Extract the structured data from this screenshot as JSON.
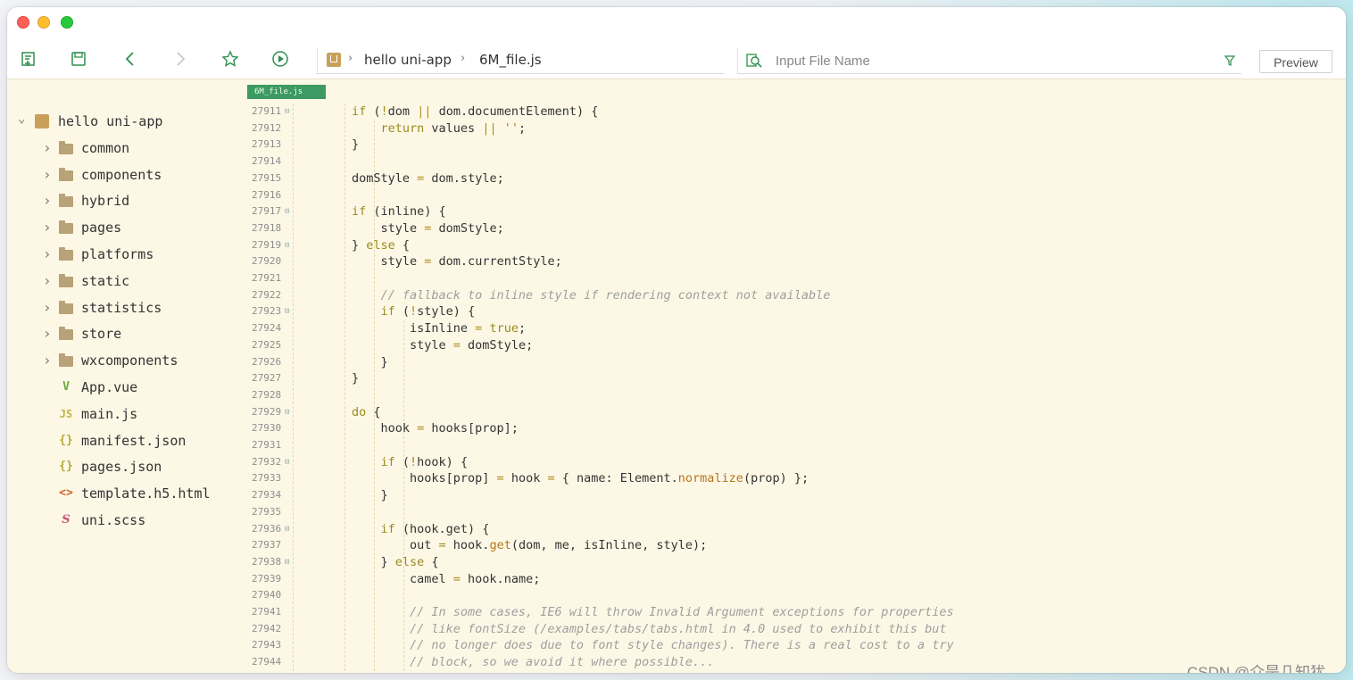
{
  "toolbar": {
    "breadcrumb": {
      "project": "hello uni-app",
      "file": "6M_file.js"
    },
    "search": {
      "placeholder": "Input File Name"
    },
    "preview_label": "Preview"
  },
  "sidebar": {
    "root": "hello uni-app",
    "folders": [
      "common",
      "components",
      "hybrid",
      "pages",
      "platforms",
      "static",
      "statistics",
      "store",
      "wxcomponents"
    ],
    "files": [
      {
        "name": "App.vue",
        "icon": "vue-icon",
        "color": "#6aa840"
      },
      {
        "name": "main.js",
        "icon": "js-icon",
        "color": "#c3b347"
      },
      {
        "name": "manifest.json",
        "icon": "json-icon",
        "color": "#b8a83a"
      },
      {
        "name": "pages.json",
        "icon": "json-icon",
        "color": "#b8a83a"
      },
      {
        "name": "template.h5.html",
        "icon": "html-icon",
        "color": "#d0622e"
      },
      {
        "name": "uni.scss",
        "icon": "scss-icon",
        "color": "#c9547a"
      }
    ]
  },
  "editor": {
    "tab_label": "6M_file.js",
    "lines": [
      {
        "n": "27911",
        "fold": true,
        "indent": 1,
        "text": "if (!dom || dom.documentElement) {"
      },
      {
        "n": "27912",
        "fold": false,
        "indent": 2,
        "text": "return values || '';"
      },
      {
        "n": "27913",
        "fold": false,
        "indent": 1,
        "text": "}"
      },
      {
        "n": "27914",
        "fold": false,
        "indent": 0,
        "text": ""
      },
      {
        "n": "27915",
        "fold": false,
        "indent": 1,
        "text": "domStyle = dom.style;"
      },
      {
        "n": "27916",
        "fold": false,
        "indent": 0,
        "text": ""
      },
      {
        "n": "27917",
        "fold": true,
        "indent": 1,
        "text": "if (inline) {"
      },
      {
        "n": "27918",
        "fold": false,
        "indent": 2,
        "text": "style = domStyle;"
      },
      {
        "n": "27919",
        "fold": true,
        "indent": 1,
        "text": "} else {"
      },
      {
        "n": "27920",
        "fold": false,
        "indent": 2,
        "text": "style = dom.currentStyle;"
      },
      {
        "n": "27921",
        "fold": false,
        "indent": 0,
        "text": ""
      },
      {
        "n": "27922",
        "fold": false,
        "indent": 2,
        "text": "// fallback to inline style if rendering context not available"
      },
      {
        "n": "27923",
        "fold": true,
        "indent": 2,
        "text": "if (!style) {"
      },
      {
        "n": "27924",
        "fold": false,
        "indent": 3,
        "text": "isInline = true;"
      },
      {
        "n": "27925",
        "fold": false,
        "indent": 3,
        "text": "style = domStyle;"
      },
      {
        "n": "27926",
        "fold": false,
        "indent": 2,
        "text": "}"
      },
      {
        "n": "27927",
        "fold": false,
        "indent": 1,
        "text": "}"
      },
      {
        "n": "27928",
        "fold": false,
        "indent": 0,
        "text": ""
      },
      {
        "n": "27929",
        "fold": true,
        "indent": 1,
        "text": "do {"
      },
      {
        "n": "27930",
        "fold": false,
        "indent": 2,
        "text": "hook = hooks[prop];"
      },
      {
        "n": "27931",
        "fold": false,
        "indent": 0,
        "text": ""
      },
      {
        "n": "27932",
        "fold": true,
        "indent": 2,
        "text": "if (!hook) {"
      },
      {
        "n": "27933",
        "fold": false,
        "indent": 3,
        "text": "hooks[prop] = hook = { name: Element.normalize(prop) };"
      },
      {
        "n": "27934",
        "fold": false,
        "indent": 2,
        "text": "}"
      },
      {
        "n": "27935",
        "fold": false,
        "indent": 0,
        "text": ""
      },
      {
        "n": "27936",
        "fold": true,
        "indent": 2,
        "text": "if (hook.get) {"
      },
      {
        "n": "27937",
        "fold": false,
        "indent": 3,
        "text": "out = hook.get(dom, me, isInline, style);"
      },
      {
        "n": "27938",
        "fold": true,
        "indent": 2,
        "text": "} else {"
      },
      {
        "n": "27939",
        "fold": false,
        "indent": 3,
        "text": "camel = hook.name;"
      },
      {
        "n": "27940",
        "fold": false,
        "indent": 0,
        "text": ""
      },
      {
        "n": "27941",
        "fold": false,
        "indent": 3,
        "text": "// In some cases, IE6 will throw Invalid Argument exceptions for properties"
      },
      {
        "n": "27942",
        "fold": false,
        "indent": 3,
        "text": "// like fontSize (/examples/tabs/tabs.html in 4.0 used to exhibit this but"
      },
      {
        "n": "27943",
        "fold": false,
        "indent": 3,
        "text": "// no longer does due to font style changes). There is a real cost to a try"
      },
      {
        "n": "27944",
        "fold": false,
        "indent": 3,
        "text": "// block, so we avoid it where possible..."
      }
    ]
  },
  "watermark": "CSDN @介是几知犹",
  "colors": {
    "editor_bg": "#fdf8e6",
    "accent_green": "#3d9a62",
    "keyword": "#9a8a1c"
  }
}
